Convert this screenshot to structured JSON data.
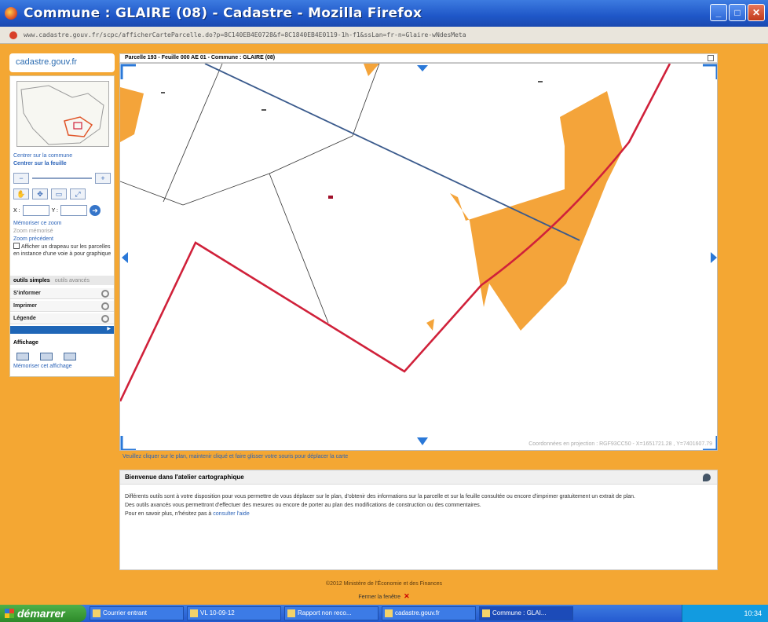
{
  "window": {
    "title": "Commune : GLAIRE (08) - Cadastre - Mozilla Firefox",
    "url": "www.cadastre.gouv.fr/scpc/afficherCarteParcelle.do?p=8C140EB4E0728&f=8C1840EB4E0119-1h-f1&ssLan=fr-n=Glaire-wNdesMeta"
  },
  "header": {
    "logo": "cadastre.gouv.fr"
  },
  "left_panel": {
    "link_center_commune": "Centrer sur la commune",
    "link_center_feuille": "Centrer sur la feuille",
    "x_label": "X :",
    "y_label": "Y :",
    "link_memoriser": "Mémoriser ce zoom",
    "link_zoom_memorise": "Zoom mémorisé",
    "link_zoom_precedent": "Zoom précédent",
    "checkbox_label": "Afficher un drapeau sur les parcelles en instance d'une voie à pour graphique",
    "tab_simple": "outils simples",
    "tab_advanced": "outils avancés",
    "section_informer": "S'informer",
    "section_imprimer": "Imprimer",
    "section_legende": "Légende",
    "affichage_label": "Affichage",
    "affichage_link": "Mémoriser cet affichage"
  },
  "map": {
    "header": "Parcelle 193 - Feuille 000 AE 01 - Commune : GLAIRE (08)",
    "footer": "Coordonnées en projection : RGF93CC50 - X=1651721.28 , Y=7401607.79",
    "hint": "Veuillez cliquer sur le plan, maintenir cliqué et faire glisser votre souris pour déplacer la carte"
  },
  "welcome": {
    "title": "Bienvenue dans l'atelier cartographique",
    "p1": "Différents outils sont à votre disposition pour vous permettre de vous déplacer sur le plan, d'obtenir des informations sur la parcelle et sur la feuille consultée ou encore d'imprimer gratuitement un extrait de plan.",
    "p2": "Des outils avancés vous permettront d'effectuer des mesures ou encore de porter au plan des modifications de construction ou des commentaires.",
    "p3_prefix": "Pour en savoir plus, n'hésitez pas à ",
    "p3_link": "consulter l'aide"
  },
  "footer": {
    "copyright": "©2012 Ministère de l'Économie et des Finances",
    "close_label": "Fermer la fenêtre"
  },
  "taskbar": {
    "start": "démarrer",
    "tasks": [
      "Courrier entrant",
      "VL 10-09-12",
      "Rapport non reco...",
      "cadastre.gouv.fr",
      "Commune : GLAI..."
    ],
    "clock": "10:34"
  },
  "colors": {
    "accent": "#f4a733",
    "boundary": "#d0213a",
    "rail": "#3a5a8c",
    "parcel_fill": "#f4a43a"
  }
}
